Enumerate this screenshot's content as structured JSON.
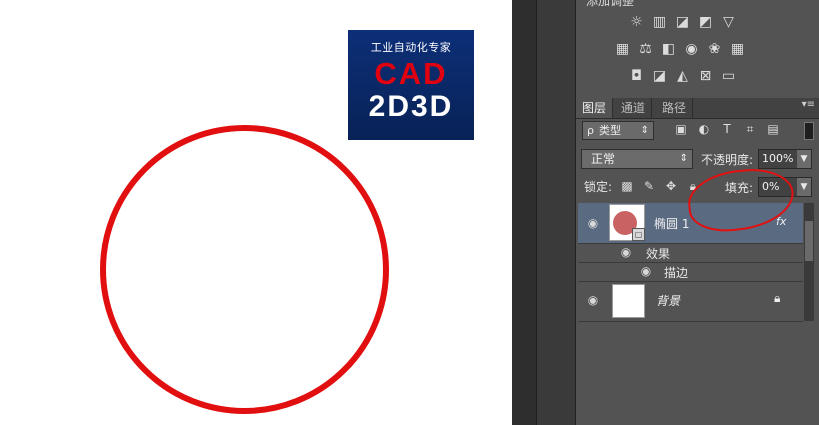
{
  "canvas": {
    "logo": {
      "line1": "工业自动化专家",
      "line2": "CAD",
      "line3": "2D3D"
    },
    "circle_color": "#e10f0f"
  },
  "adjustments": {
    "header": "添加调整",
    "rows": [
      [
        "brightness-icon",
        "levels-icon",
        "curves-icon",
        "exposure-icon",
        "vibrance-icon"
      ],
      [
        "hue-saturation-icon",
        "color-balance-icon",
        "black-white-icon",
        "photo-filter-icon",
        "channel-mixer-icon",
        "color-lookup-icon"
      ],
      [
        "invert-icon",
        "posterize-icon",
        "threshold-icon",
        "selective-color-icon",
        "gradient-map-icon"
      ]
    ]
  },
  "layers_panel": {
    "tabs": [
      "图层",
      "通道",
      "路径"
    ],
    "menu": "▾≡",
    "filter": {
      "search": "ρ",
      "label": "类型",
      "arrows": "⇕"
    },
    "blend_mode": "正常",
    "opacity_label": "不透明度:",
    "opacity_value": "100%",
    "lock_label": "锁定:",
    "fill_label": "填充:",
    "fill_value": "0%",
    "layers": [
      {
        "name": "椭圆 1",
        "fx": "fx",
        "selected": true
      },
      {
        "name": "背景",
        "locked": true
      }
    ],
    "effects_label": "效果",
    "stroke_label": "描边"
  },
  "colors": {
    "selected_layer": "#5a6a80",
    "annotation": "#e21010"
  }
}
